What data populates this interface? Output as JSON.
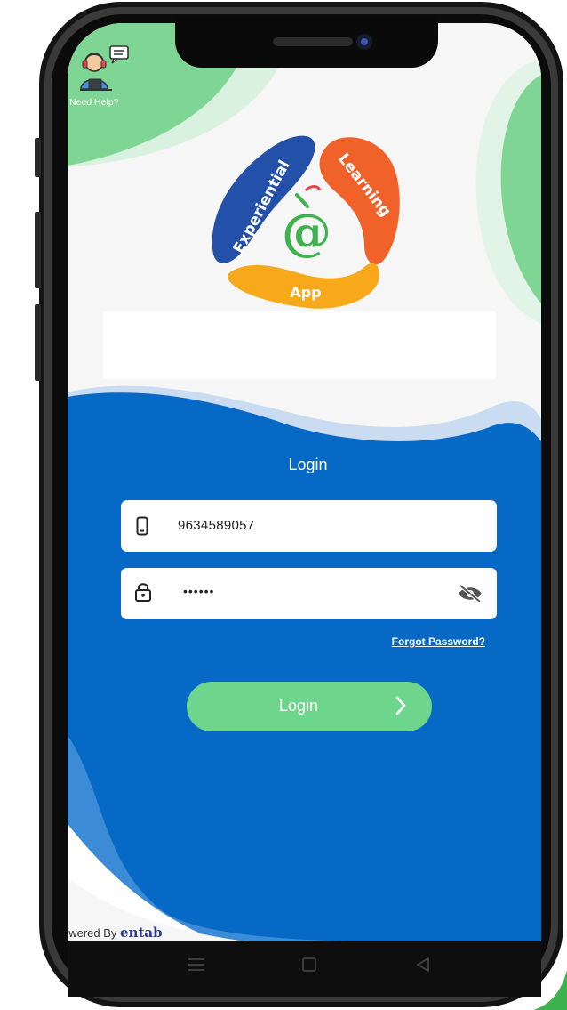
{
  "help": {
    "label": "Need Help?",
    "icon": "support-agent-icon"
  },
  "logo": {
    "word_left": "Experiential",
    "word_right": "Learning",
    "word_bottom": "App",
    "center_symbol": "@",
    "colors": {
      "blue": "#2350a8",
      "orange": "#f0622a",
      "yellow": "#f7a91b",
      "green": "#3eb24f"
    }
  },
  "login": {
    "title": "Login",
    "mobile_value": "9634589057",
    "password_value": "••••••",
    "forgot_label": "Forgot Password?",
    "button_label": "Login"
  },
  "footer": {
    "powered_prefix": "owered By",
    "brand": "entab"
  },
  "colors": {
    "primary_blue": "#0669c6",
    "accent_green": "#6ed58c",
    "light_green": "#7fd694",
    "background": "#f6f6f6"
  },
  "icons": {
    "phone": "mobile-phone-icon",
    "lock": "lock-icon",
    "eye": "eye-off-icon",
    "chevron": "chevron-right-icon",
    "menu": "menu-icon",
    "home": "home-square-icon",
    "back": "back-triangle-icon"
  }
}
